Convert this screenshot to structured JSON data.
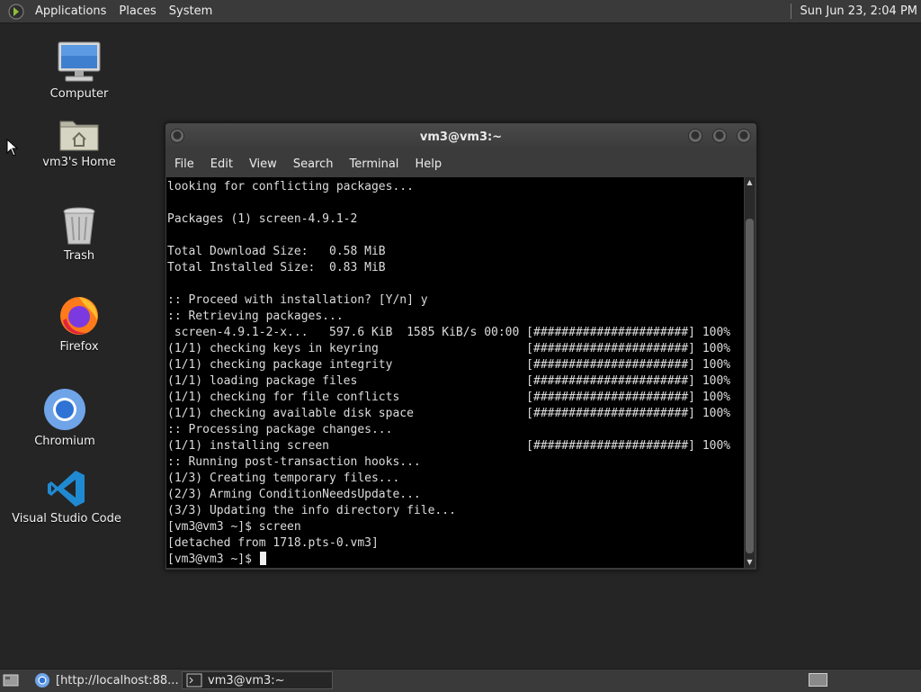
{
  "top_panel": {
    "menus": [
      "Applications",
      "Places",
      "System"
    ],
    "clock": "Sun Jun 23,  2:04 PM"
  },
  "desktop": {
    "icons": [
      {
        "label": "Computer",
        "icon": "computer-icon"
      },
      {
        "label": "vm3's Home",
        "icon": "home-folder-icon"
      },
      {
        "label": "Trash",
        "icon": "trash-icon"
      },
      {
        "label": "Firefox",
        "icon": "firefox-icon"
      },
      {
        "label": "Chromium",
        "icon": "chromium-icon"
      },
      {
        "label": "Visual Studio Code",
        "icon": "vscode-icon"
      }
    ]
  },
  "terminal": {
    "title": "vm3@vm3:~",
    "menu": [
      "File",
      "Edit",
      "View",
      "Search",
      "Terminal",
      "Help"
    ],
    "lines": [
      "looking for conflicting packages...",
      "",
      "Packages (1) screen-4.9.1-2",
      "",
      "Total Download Size:   0.58 MiB",
      "Total Installed Size:  0.83 MiB",
      "",
      ":: Proceed with installation? [Y/n] y",
      ":: Retrieving packages...",
      " screen-4.9.1-2-x...   597.6 KiB  1585 KiB/s 00:00 [######################] 100%",
      "(1/1) checking keys in keyring                     [######################] 100%",
      "(1/1) checking package integrity                   [######################] 100%",
      "(1/1) loading package files                        [######################] 100%",
      "(1/1) checking for file conflicts                  [######################] 100%",
      "(1/1) checking available disk space                [######################] 100%",
      ":: Processing package changes...",
      "(1/1) installing screen                            [######################] 100%",
      ":: Running post-transaction hooks...",
      "(1/3) Creating temporary files...",
      "(2/3) Arming ConditionNeedsUpdate...",
      "(3/3) Updating the info directory file...",
      "[vm3@vm3 ~]$ screen",
      "[detached from 1718.pts-0.vm3]"
    ],
    "prompt": "[vm3@vm3 ~]$ "
  },
  "taskbar": {
    "tasks": [
      {
        "label": "[http://localhost:88...",
        "icon": "chromium-icon",
        "active": false
      },
      {
        "label": "vm3@vm3:~",
        "icon": "terminal-icon",
        "active": true
      }
    ]
  },
  "colors": {
    "desktop_bg": "#252525",
    "panel_bg": "#3a3a3a",
    "terminal_bg": "#000000",
    "terminal_fg": "#dcdcdc"
  }
}
